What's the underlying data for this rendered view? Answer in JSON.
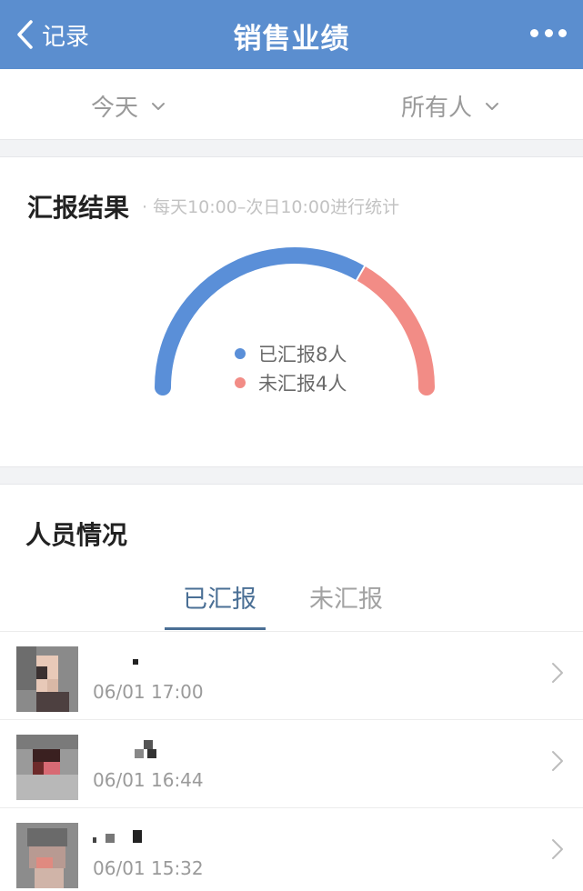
{
  "navbar": {
    "back_label": "记录",
    "title": "销售业绩",
    "back_icon": "chevron-left-icon",
    "more_icon": "more-dots-icon",
    "color": "#5b8ecf"
  },
  "filters": {
    "date": "今天",
    "person": "所有人"
  },
  "report": {
    "title": "汇报结果",
    "note": "· 每天10:00–次日10:00进行统计",
    "legend": [
      {
        "label": "已汇报8人",
        "color": "#5a8fd8"
      },
      {
        "label": "未汇报4人",
        "color": "#f28c86"
      }
    ]
  },
  "chart_data": {
    "type": "pie",
    "title": "",
    "categories": [
      "已汇报",
      "未汇报"
    ],
    "values": [
      8,
      4
    ],
    "colors": [
      "#5a8fd8",
      "#f28c86"
    ]
  },
  "people": {
    "title": "人员情况",
    "tabs": [
      {
        "label": "已汇报",
        "active": true
      },
      {
        "label": "未汇报",
        "active": false
      }
    ],
    "rows": [
      {
        "time": "06/01 17:00"
      },
      {
        "time": "06/01 16:44"
      },
      {
        "time": "06/01 15:32"
      }
    ]
  }
}
